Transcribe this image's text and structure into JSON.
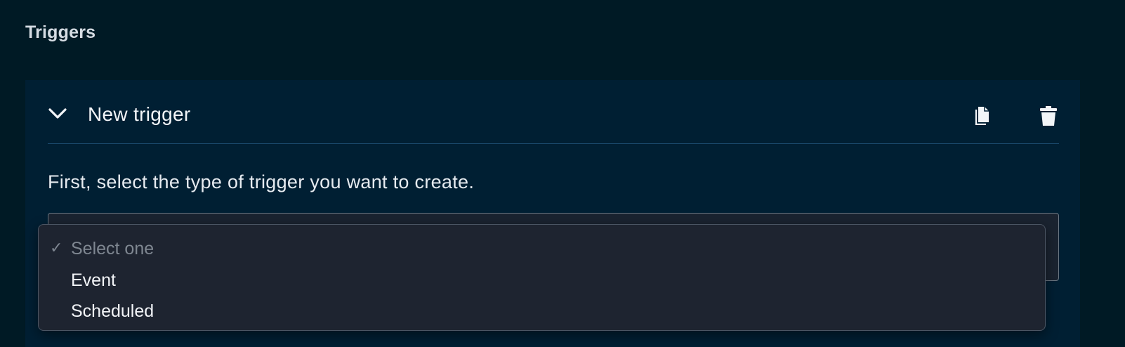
{
  "section": {
    "title": "Triggers"
  },
  "trigger_card": {
    "title": "New trigger",
    "icons": {
      "collapse": "chevron-down-icon",
      "copy": "copy-icon",
      "delete": "trash-icon"
    },
    "prompt": "First, select the type of trigger you want to create.",
    "select": {
      "selected_value": "Select one",
      "options": [
        {
          "label": "Select one",
          "checked": true
        },
        {
          "label": "Event",
          "checked": false
        },
        {
          "label": "Scheduled",
          "checked": false
        }
      ]
    }
  },
  "colors": {
    "page_background": "#001a25",
    "card_background": "#001f33",
    "divider": "#1b4a6e",
    "dropdown_background": "#1e2430",
    "placeholder_text": "#7f8791",
    "option_text": "#f2f4f7"
  }
}
